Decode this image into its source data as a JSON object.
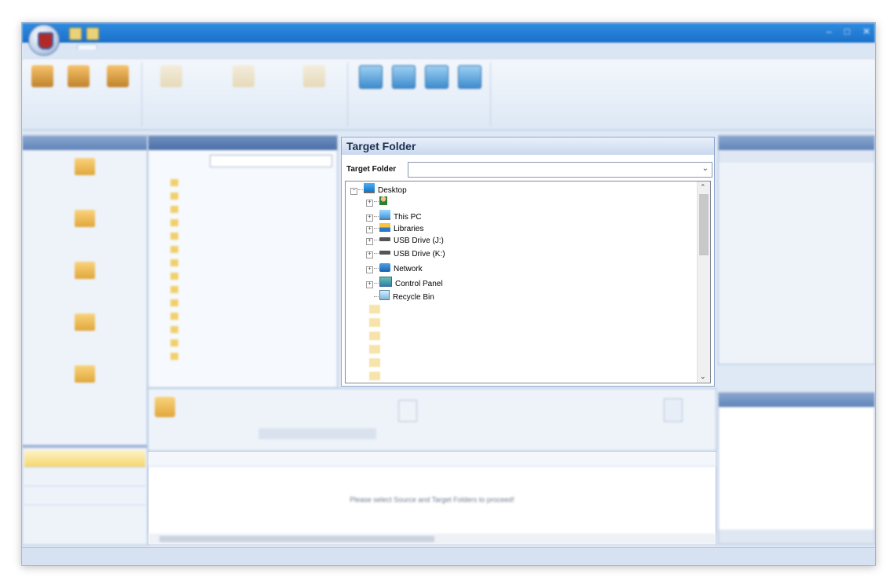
{
  "target_folder": {
    "header": "Target Folder",
    "label": "Target Folder",
    "combo_value": "",
    "tree": [
      {
        "label": "Desktop",
        "icon": "desktop-icon",
        "expander": "minus"
      },
      {
        "label": "",
        "icon": "user-folder-icon",
        "expander": "plus"
      },
      {
        "label": "This PC",
        "icon": "computer-icon",
        "expander": "plus"
      },
      {
        "label": "Libraries",
        "icon": "libraries-icon",
        "expander": "plus"
      },
      {
        "label": "USB Drive (J:)",
        "icon": "drive-icon",
        "expander": "plus"
      },
      {
        "label": "USB Drive (K:)",
        "icon": "drive-icon",
        "expander": "plus"
      },
      {
        "label": "Network",
        "icon": "network-icon",
        "expander": "plus"
      },
      {
        "label": "Control Panel",
        "icon": "control-panel-icon",
        "expander": "plus"
      },
      {
        "label": "Recycle Bin",
        "icon": "recycle-bin-icon",
        "expander": "none"
      }
    ]
  },
  "grid": {
    "empty_message": "Please select Source and Target Folders to proceed!"
  },
  "colors": {
    "titlebar": "#1a6fc9",
    "ribbon": "#dde8f5",
    "pane_header": "#5f83b8",
    "selection": "#f6d66c"
  }
}
